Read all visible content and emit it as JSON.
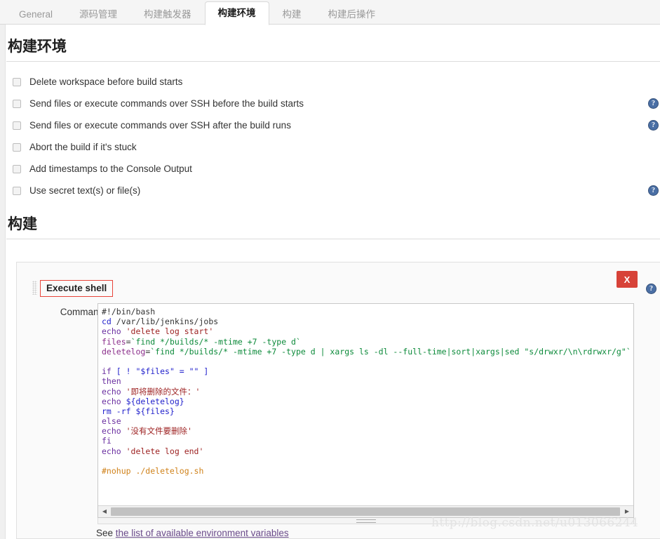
{
  "tabs": [
    {
      "label": "General",
      "active": false
    },
    {
      "label": "源码管理",
      "active": false
    },
    {
      "label": "构建触发器",
      "active": false
    },
    {
      "label": "构建环境",
      "active": true
    },
    {
      "label": "构建",
      "active": false
    },
    {
      "label": "构建后操作",
      "active": false
    }
  ],
  "sections": {
    "build_environment_title": "构建环境",
    "build_title": "构建"
  },
  "build_environment": {
    "options": [
      {
        "label": "Delete workspace before build starts",
        "checked": false,
        "help": false
      },
      {
        "label": "Send files or execute commands over SSH before the build starts",
        "checked": false,
        "help": true
      },
      {
        "label": "Send files or execute commands over SSH after the build runs",
        "checked": false,
        "help": true
      },
      {
        "label": "Abort the build if it's stuck",
        "checked": false,
        "help": false
      },
      {
        "label": "Add timestamps to the Console Output",
        "checked": false,
        "help": false
      },
      {
        "label": "Use secret text(s) or file(s)",
        "checked": false,
        "help": true
      }
    ]
  },
  "build_step": {
    "title": "Execute shell",
    "delete_label": "X",
    "command_label": "Command",
    "help_symbol": "?",
    "env_note_prefix": "See ",
    "env_note_link": "the list of available environment variables",
    "script_lines": [
      [
        {
          "t": "#!/bin/bash",
          "c": "p"
        }
      ],
      [
        {
          "t": "cd ",
          "c": "kb"
        },
        {
          "t": "/var/lib/jenkins/jobs",
          "c": "p"
        }
      ],
      [
        {
          "t": "echo ",
          "c": "k"
        },
        {
          "t": "'delete log start'",
          "c": "s"
        }
      ],
      [
        {
          "t": "files",
          "c": "v"
        },
        {
          "t": "=",
          "c": "p"
        },
        {
          "t": "`find */builds/* -mtime +7 -type d`",
          "c": "g"
        }
      ],
      [
        {
          "t": "deletelog",
          "c": "v"
        },
        {
          "t": "=",
          "c": "p"
        },
        {
          "t": "`find */builds/* -mtime +7 -type d | xargs ls -dl --full-time|sort|xargs|sed \"s/drwxr/\\n\\rdrwxr/g\"`",
          "c": "g"
        }
      ],
      [
        {
          "t": "",
          "c": "p"
        }
      ],
      [
        {
          "t": "if ",
          "c": "k"
        },
        {
          "t": "[ ! \"$files\" = \"\" ]",
          "c": "kb"
        }
      ],
      [
        {
          "t": "then",
          "c": "k"
        }
      ],
      [
        {
          "t": "echo ",
          "c": "k"
        },
        {
          "t": "'即将删除的文件：'",
          "c": "s"
        }
      ],
      [
        {
          "t": "echo ",
          "c": "k"
        },
        {
          "t": "${deletelog}",
          "c": "kb"
        }
      ],
      [
        {
          "t": "rm -rf ",
          "c": "kb"
        },
        {
          "t": "${files}",
          "c": "kb"
        }
      ],
      [
        {
          "t": "else",
          "c": "k"
        }
      ],
      [
        {
          "t": "echo ",
          "c": "k"
        },
        {
          "t": "'没有文件要删除'",
          "c": "s"
        }
      ],
      [
        {
          "t": "fi",
          "c": "k"
        }
      ],
      [
        {
          "t": "echo ",
          "c": "k"
        },
        {
          "t": "'delete log end'",
          "c": "s"
        }
      ],
      [
        {
          "t": "",
          "c": "p"
        }
      ],
      [
        {
          "t": "#nohup ./deletelog.sh",
          "c": "c"
        }
      ]
    ]
  },
  "watermark": "http://blog.csdn.net/u013066244",
  "colors": {
    "accent_red": "#d74238",
    "annotation_red": "#e8443a",
    "help_blue": "#4a6fa5",
    "link_purple": "#6a4b8a"
  }
}
